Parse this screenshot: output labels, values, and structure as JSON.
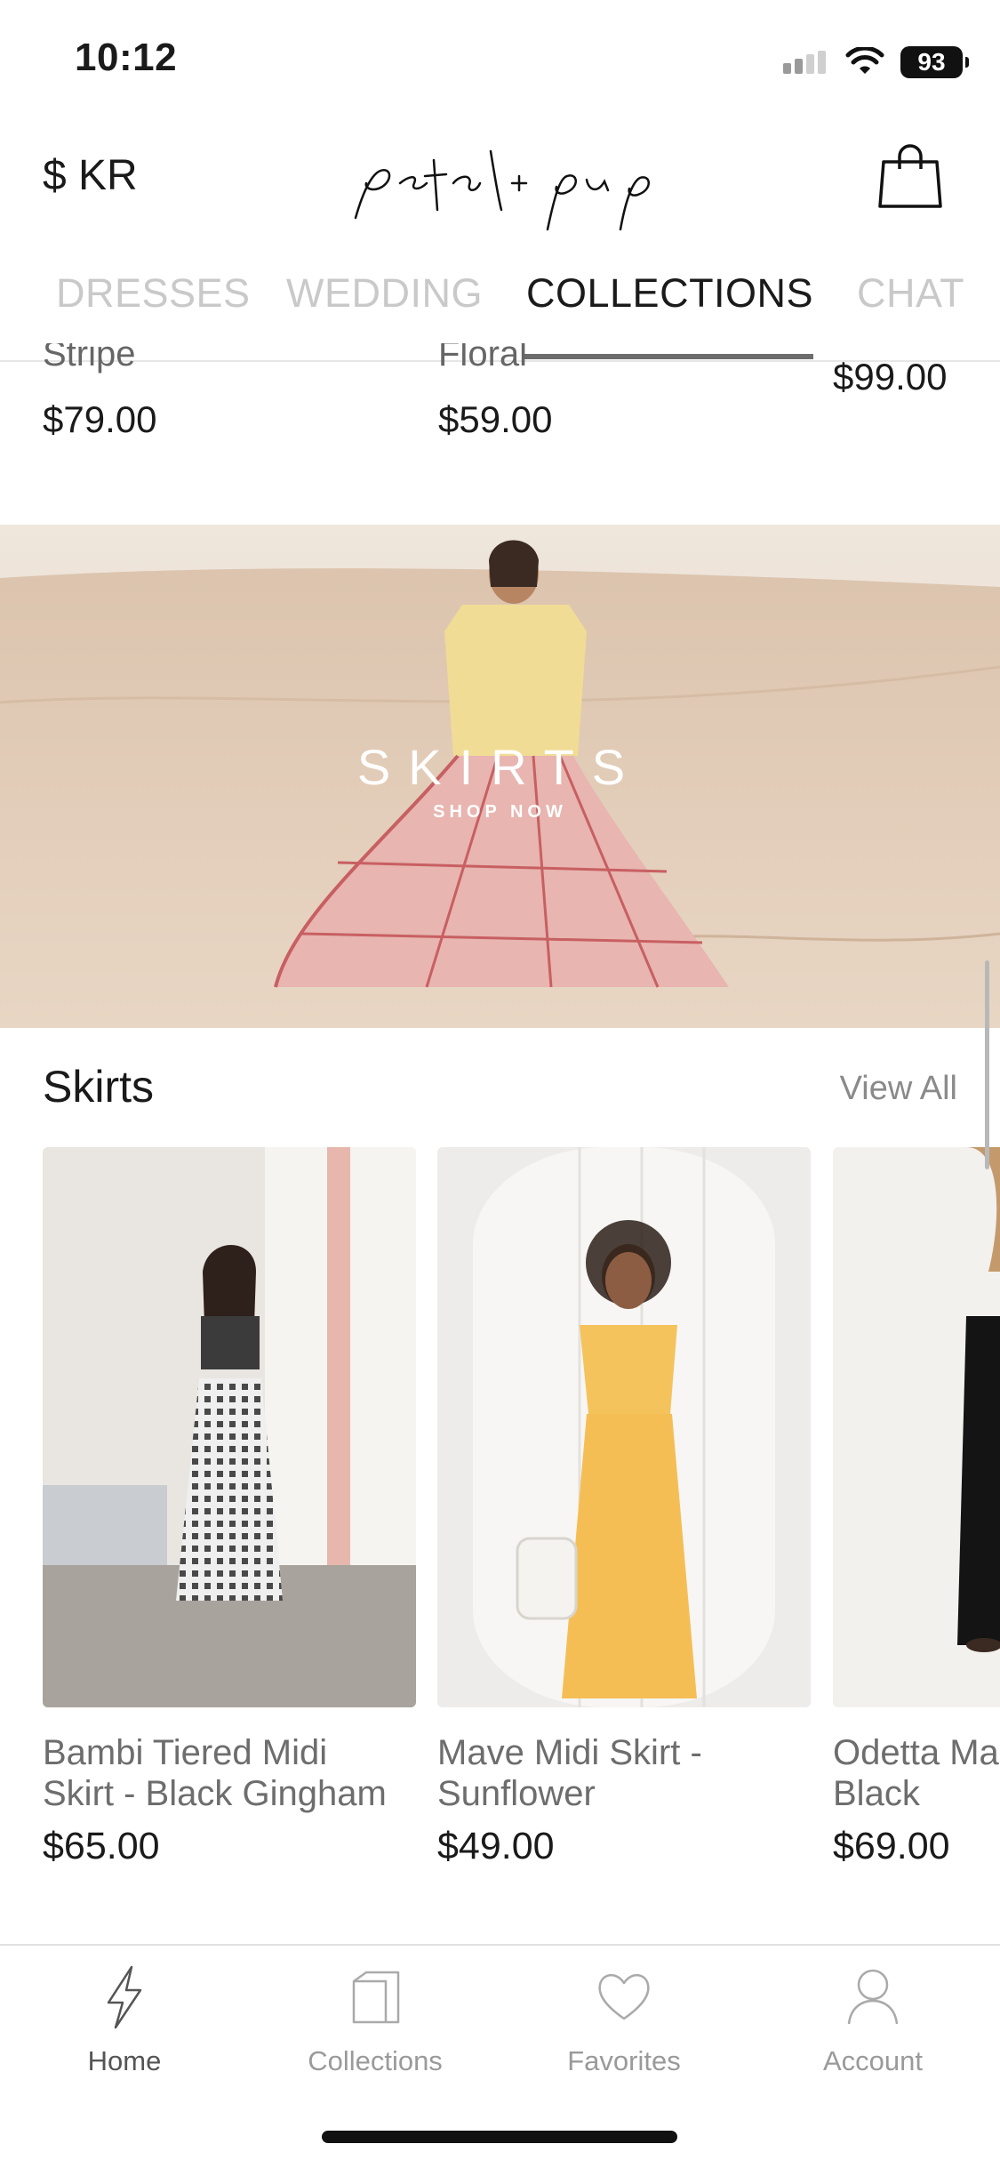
{
  "status_bar": {
    "time": "10:12",
    "battery": "93"
  },
  "header": {
    "currency": "$ KR",
    "logo": "petal + pup"
  },
  "tabs": [
    {
      "label": "DRESSES",
      "active": false
    },
    {
      "label": "WEDDING",
      "active": false
    },
    {
      "label": "COLLECTIONS",
      "active": true
    },
    {
      "label": "CHAT",
      "active": false
    }
  ],
  "previous_row": [
    {
      "name_fragment": "Stripe",
      "price": "$79.00"
    },
    {
      "name_fragment": "Floral",
      "price": "$59.00"
    },
    {
      "name_fragment": "",
      "price": "$99.00"
    }
  ],
  "banner": {
    "title": "SKIRTS",
    "subtitle": "SHOP NOW"
  },
  "section": {
    "title": "Skirts",
    "view_all": "View All"
  },
  "products": [
    {
      "name_line1": "Bambi Tiered Midi",
      "name_line2": "Skirt - Black Gingham",
      "price": "$65.00"
    },
    {
      "name_line1": "Mave Midi Skirt -",
      "name_line2": "Sunflower",
      "price": "$49.00"
    },
    {
      "name_line1": "Odetta Ma",
      "name_line2": "Black",
      "price": "$69.00"
    }
  ],
  "bottom_nav": [
    {
      "label": "Home",
      "icon": "lightning-icon",
      "active": true
    },
    {
      "label": "Collections",
      "icon": "collections-icon",
      "active": false
    },
    {
      "label": "Favorites",
      "icon": "heart-icon",
      "active": false
    },
    {
      "label": "Account",
      "icon": "person-icon",
      "active": false
    }
  ]
}
